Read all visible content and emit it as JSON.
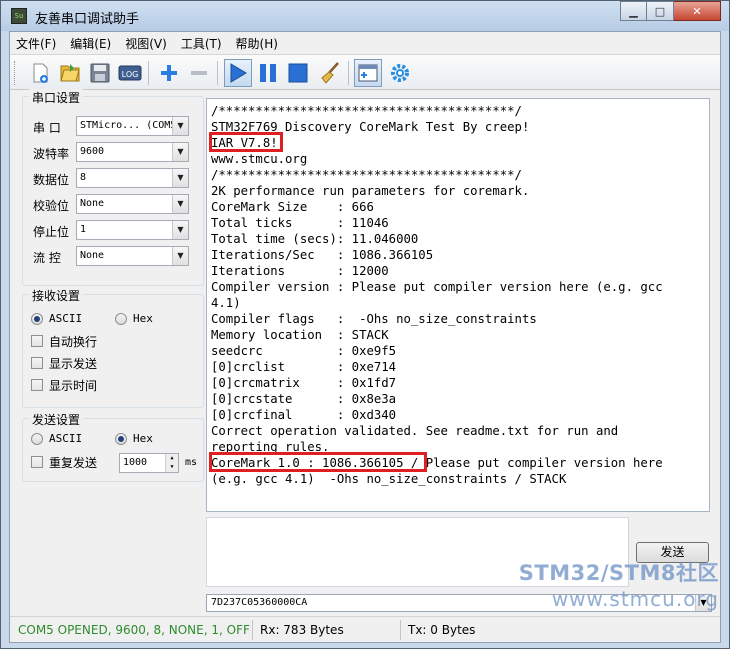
{
  "window": {
    "title": "友善串口调试助手",
    "app_icon_text": "Su",
    "minimize": "▭",
    "maximize": "□",
    "close": "✕"
  },
  "menu": [
    {
      "label": "文件(F)"
    },
    {
      "label": "编辑(E)"
    },
    {
      "label": "视图(V)"
    },
    {
      "label": "工具(T)"
    },
    {
      "label": "帮助(H)"
    }
  ],
  "toolbar": {
    "icons": [
      "new-icon",
      "open-icon",
      "save-icon",
      "log-icon",
      "add-icon",
      "remove-icon",
      "play-icon",
      "pause-icon",
      "stop-icon",
      "clear-broom-icon",
      "window-icon",
      "settings-gear-icon"
    ],
    "log_text": "LOG",
    "active": "play"
  },
  "serial_settings": {
    "title": "串口设置",
    "rows": [
      {
        "label": "串  口",
        "value": "STMicro... (COM5"
      },
      {
        "label": "波特率",
        "value": "9600"
      },
      {
        "label": "数据位",
        "value": "8"
      },
      {
        "label": "校验位",
        "value": "None"
      },
      {
        "label": "停止位",
        "value": "1"
      },
      {
        "label": "流  控",
        "value": "None"
      }
    ]
  },
  "receive_settings": {
    "title": "接收设置",
    "ascii": "ASCII",
    "hex": "Hex",
    "selected": "ASCII",
    "checks": [
      {
        "label": "自动换行",
        "checked": false
      },
      {
        "label": "显示发送",
        "checked": false
      },
      {
        "label": "显示时间",
        "checked": false
      }
    ]
  },
  "send_settings": {
    "title": "发送设置",
    "ascii": "ASCII",
    "hex": "Hex",
    "selected": "Hex",
    "repeat_label": "重复发送",
    "repeat_checked": false,
    "interval": "1000",
    "unit": "ms"
  },
  "terminal": {
    "lines": [
      "/****************************************/",
      "STM32F769 Discovery CoreMark Test By creep!",
      "IAR V7.8!",
      "www.stmcu.org",
      "/****************************************/",
      "2K performance run parameters for coremark.",
      "CoreMark Size    : 666",
      "Total ticks      : 11046",
      "Total time (secs): 11.046000",
      "Iterations/Sec   : 1086.366105",
      "Iterations       : 12000",
      "Compiler version : Please put compiler version here (e.g. gcc",
      "4.1)",
      "Compiler flags   :  -Ohs no_size_constraints",
      "Memory location  : STACK",
      "seedcrc          : 0xe9f5",
      "[0]crclist       : 0xe714",
      "[0]crcmatrix     : 0x1fd7",
      "[0]crcstate      : 0x8e3a",
      "[0]crcfinal      : 0xd340",
      "Correct operation validated. See readme.txt for run and",
      "reporting rules.",
      "CoreMark 1.0 : 1086.366105 / Please put compiler version here",
      "(e.g. gcc 4.1)  -Ohs no_size_constraints / STACK"
    ]
  },
  "send": {
    "input_value": "",
    "button": "发送",
    "command": "7D237C05360000CA"
  },
  "status": {
    "port": "COM5 OPENED, 9600, 8, NONE, 1, OFF",
    "port_color": "#2e8b2e",
    "rx": "Rx: 783 Bytes",
    "tx": "Tx: 0 Bytes"
  },
  "watermark": {
    "line1": "STM32/STM8社区",
    "line2": "www.stmcu.org"
  }
}
